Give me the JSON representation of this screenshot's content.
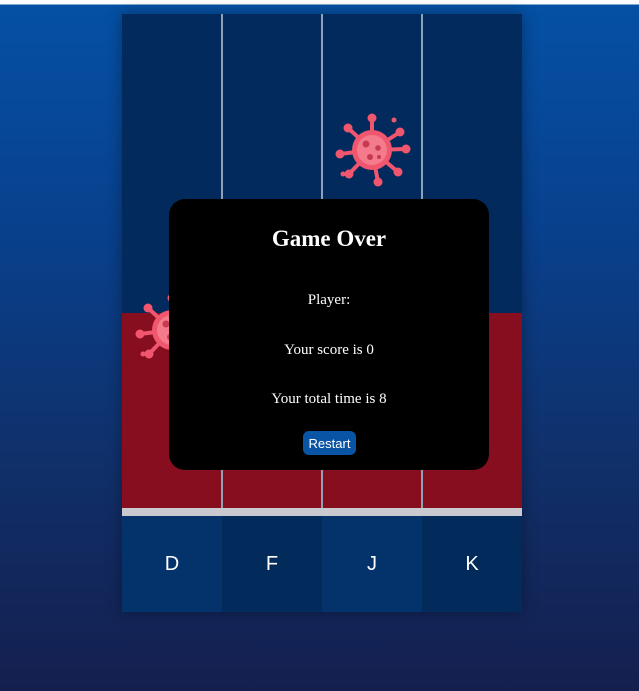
{
  "game": {
    "lanes": [
      {
        "key": "D"
      },
      {
        "key": "F"
      },
      {
        "key": "J"
      },
      {
        "key": "K"
      }
    ],
    "enemy_icon": "virus-icon",
    "colors": {
      "playfield": "#022a5c",
      "danger_zone": "#870e1e",
      "hit_bar": "#c9c9cf",
      "virus": "#f0566e"
    }
  },
  "modal": {
    "title": "Game Over",
    "player_label": "Player:",
    "score_text": "Your score is 0",
    "time_text": "Your total time is 8",
    "restart_label": "Restart",
    "restart_color": "#0a54a6"
  }
}
